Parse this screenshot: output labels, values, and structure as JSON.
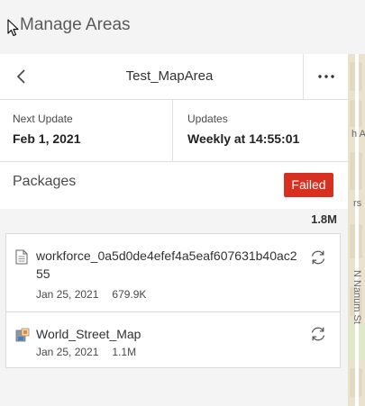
{
  "app": {
    "title": "Manage Areas"
  },
  "area": {
    "name": "Test_MapArea"
  },
  "schedule": {
    "next_update_label": "Next Update",
    "next_update_value": "Feb 1, 2021",
    "updates_label": "Updates",
    "updates_value": "Weekly at 14:55:01"
  },
  "packages": {
    "title": "Packages",
    "status": "Failed",
    "status_color": "#d83020",
    "total_size": "1.8M",
    "items": [
      {
        "name": "workforce_0a5d0de4efef4a5eaf607631b40ac255",
        "date": "Jan 25, 2021",
        "size": "679.9K",
        "icon": "document-icon"
      },
      {
        "name": "World_Street_Map",
        "date": "Jan 25, 2021",
        "size": "1.1M",
        "icon": "tile-package-icon"
      }
    ]
  },
  "map": {
    "labels": [
      "h A",
      "rs",
      "N Nanum St"
    ]
  }
}
